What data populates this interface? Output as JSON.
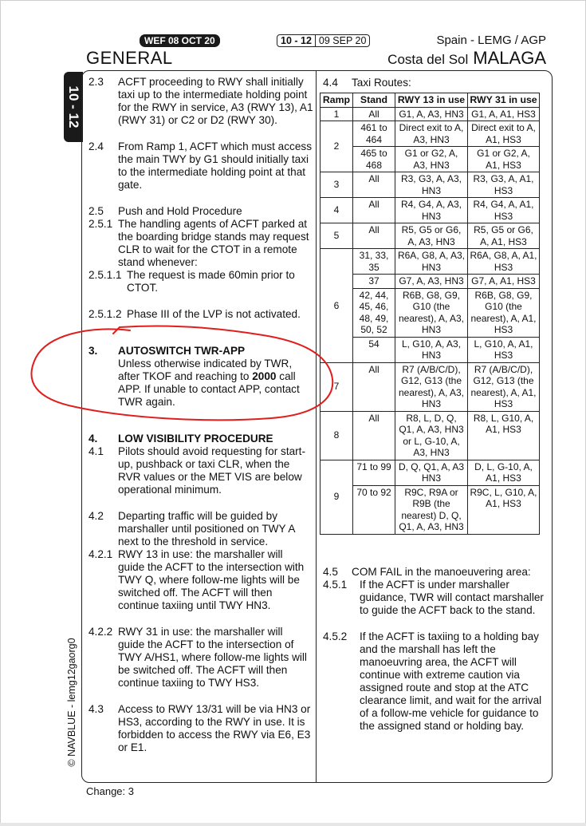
{
  "header": {
    "wef": "WEF 08 OCT 20",
    "page_number": "10 - 12",
    "page_date": "09 SEP 20",
    "country_code": "Spain - LEMG / AGP",
    "section": "GENERAL",
    "location": "Costa del Sol",
    "city": "MALAGA",
    "side_tab": "10 - 12"
  },
  "left": [
    {
      "num": "2.3",
      "text": "ACFT proceeding to RWY shall initially taxi up to the intermediate holding point for the RWY in service, A3 (RWY 13), A1 (RWY 31) or C2 or D2 (RWY 30)."
    },
    {
      "num": "2.4",
      "text": "From Ramp 1, ACFT which must access the main TWY by G1 should initially taxi to the intermediate holding point at that gate."
    },
    {
      "num": "2.5",
      "text": "Push and Hold Procedure"
    },
    {
      "num": "2.5.1",
      "text": "The handling agents of ACFT parked at the boarding bridge stands may request CLR to wait for the CTOT in a remote stand whenever:"
    },
    {
      "num": "2.5.1.1",
      "text": "The request is made 60min prior to CTOT."
    },
    {
      "num": "2.5.1.2",
      "text": "Phase III of the LVP is not activated."
    },
    {
      "num": "3.",
      "text": "AUTOSWITCH TWR-APP"
    },
    {
      "num": "",
      "text_a": "Unless otherwise indicated by TWR, after TKOF and reaching to ",
      "text_b": "2000",
      "text_c": " call APP. If unable to contact APP, contact TWR again."
    },
    {
      "num": "4.",
      "text": "LOW VISIBILITY PROCEDURE"
    },
    {
      "num": "4.1",
      "text": "Pilots should avoid requesting for start-up, pushback or taxi CLR, when the RVR values or the MET VIS are below operational minimum."
    },
    {
      "num": "4.2",
      "text": "Departing traffic will be guided by marshaller until positioned on TWY A next to the threshold in service."
    },
    {
      "num": "4.2.1",
      "text": "RWY 13 in use: the marshaller will guide the ACFT to the intersection with TWY Q, where follow-me lights will be switched off. The ACFT will then continue taxiing until TWY HN3."
    },
    {
      "num": "4.2.2",
      "text": "RWY 31 in use: the marshaller will guide the ACFT to the intersection of TWY A/HS1, where follow-me lights will be switched off. The ACFT will then continue taxiing to TWY HS3."
    },
    {
      "num": "4.3",
      "text": "Access to RWY 13/31 will be via HN3 or HS3, according to the RWY in use. It is forbidden to access the RWY via E6, E3 or E1."
    }
  ],
  "right": {
    "taxi_num": "4.4",
    "taxi_title": "Taxi Routes:",
    "table_headers": [
      "Ramp",
      "Stand",
      "RWY 13 in use",
      "RWY 31 in use"
    ],
    "rows": [
      {
        "ramp": "1",
        "stand": "All",
        "r13": "G1, A, A3, HN3",
        "r31": "G1, A, A1, HS3"
      },
      {
        "ramp": "2",
        "stand": "461 to 464",
        "r13": "Direct exit to A, A3, HN3",
        "r31": "Direct exit to A, A1, HS3"
      },
      {
        "ramp": "",
        "stand": "465 to 468",
        "r13": "G1 or G2, A, A3, HN3",
        "r31": "G1 or G2, A, A1, HS3"
      },
      {
        "ramp": "3",
        "stand": "All",
        "r13": "R3, G3, A, A3, HN3",
        "r31": "R3, G3, A, A1, HS3"
      },
      {
        "ramp": "4",
        "stand": "All",
        "r13": "R4, G4, A, A3, HN3",
        "r31": "R4, G4, A, A1, HS3"
      },
      {
        "ramp": "5",
        "stand": "All",
        "r13": "R5, G5 or G6, A, A3, HN3",
        "r31": "R5, G5 or G6, A, A1, HS3"
      },
      {
        "ramp": "6",
        "stand": "31, 33, 35",
        "r13": "R6A, G8, A, A3, HN3",
        "r31": "R6A, G8, A, A1, HS3"
      },
      {
        "ramp": "",
        "stand": "37",
        "r13": "G7, A, A3, HN3",
        "r31": "G7, A, A1, HS3"
      },
      {
        "ramp": "",
        "stand": "42, 44, 45, 46, 48, 49, 50, 52",
        "r13": "R6B, G8, G9, G10 (the nearest), A, A3, HN3",
        "r31": "R6B, G8, G9, G10 (the nearest), A, A1, HS3"
      },
      {
        "ramp": "",
        "stand": "54",
        "r13": "L, G10, A, A3, HN3",
        "r31": "L, G10, A, A1, HS3"
      },
      {
        "ramp": "7",
        "stand": "All",
        "r13": "R7 (A/B/C/D), G12, G13 (the nearest), A, A3, HN3",
        "r31": "R7 (A/B/C/D), G12, G13 (the nearest), A, A1, HS3"
      },
      {
        "ramp": "8",
        "stand": "All",
        "r13": "R8, L, D, Q, Q1, A, A3, HN3 or L, G-10, A, A3, HN3",
        "r31": "R8, L, G10, A, A1, HS3"
      },
      {
        "ramp": "9",
        "stand": "71 to 99",
        "r13": "D, Q, Q1, A, A3 HN3",
        "r31": "D, L, G-10, A, A1, HS3"
      },
      {
        "ramp": "",
        "stand": "70 to 92",
        "r13": "R9C, R9A or R9B (the nearest) D, Q, Q1, A, A3, HN3",
        "r31": "R9C, L, G10, A, A1, HS3"
      }
    ],
    "items": [
      {
        "num": "4.5",
        "text": "COM FAIL in the manoeuvering area:"
      },
      {
        "num": "4.5.1",
        "text": "If the ACFT is under marshaller guidance, TWR will contact marshaller to guide the ACFT back to the stand."
      },
      {
        "num": "4.5.2",
        "text": "If the ACFT is taxiing to a holding bay and the marshall has left the manoeuvring area, the ACFT will continue with extreme caution via assigned route and stop at the ATC clearance limit, and wait for the arrival of a follow-me vehicle for guidance to the assigned stand or holding bay."
      }
    ]
  },
  "footer": {
    "change": "Change: 3",
    "copyright": "© NAVBLUE - lemg12gaorg0"
  },
  "colors": {
    "annotation": "#e01e1e",
    "tab_bg": "#1a1a1a"
  }
}
